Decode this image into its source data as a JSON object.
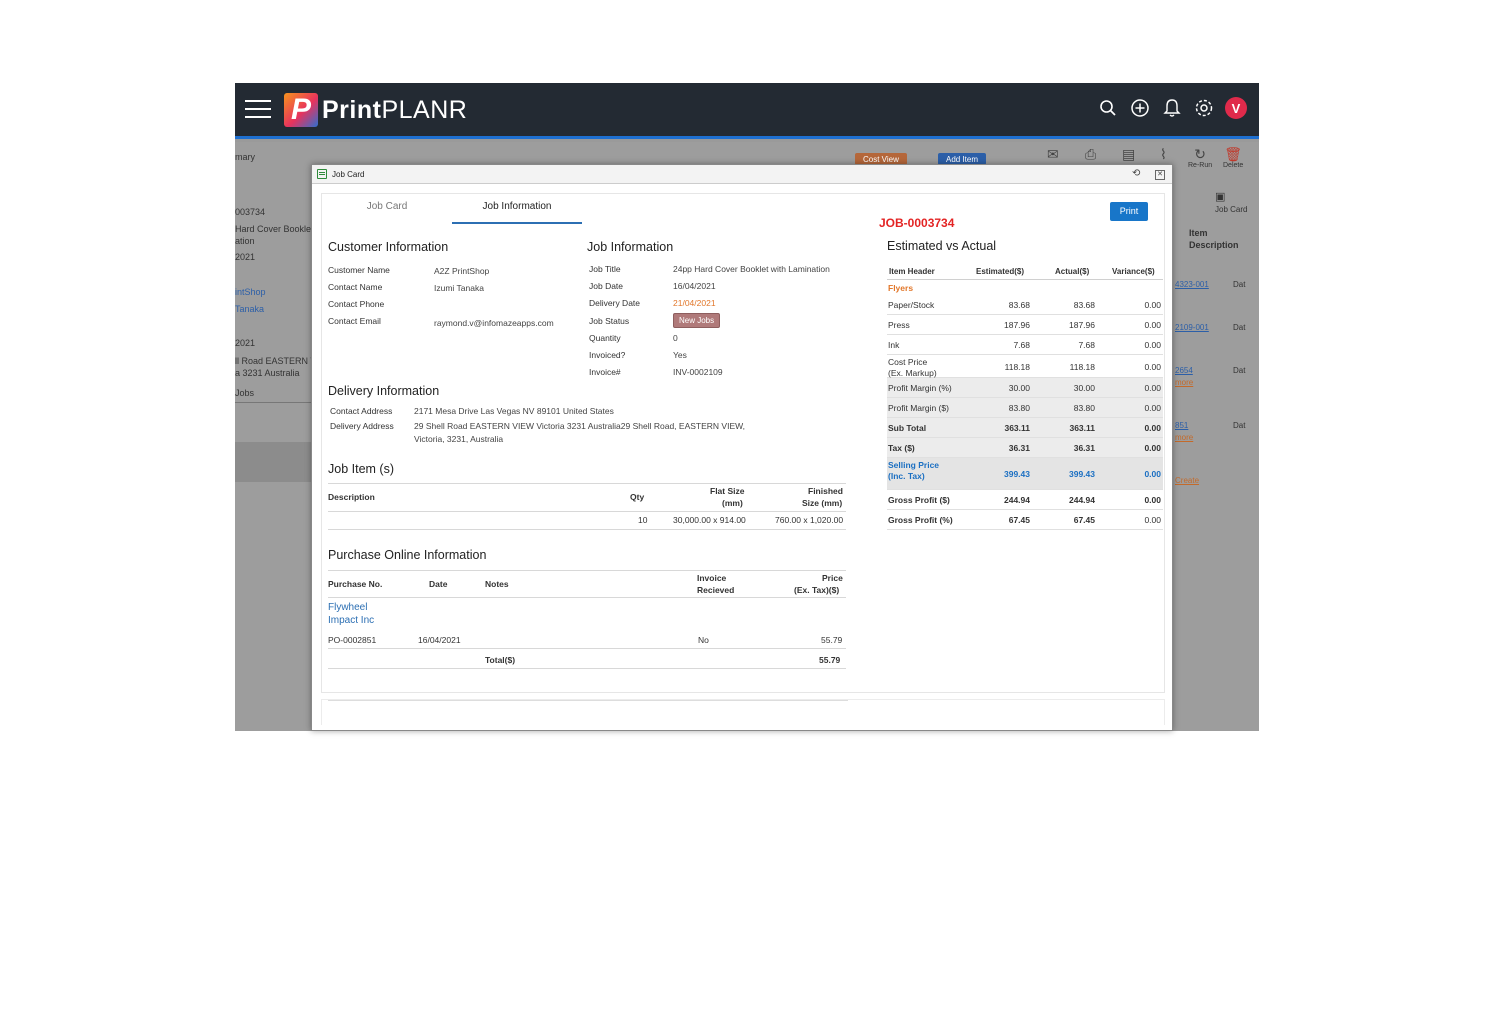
{
  "app": {
    "logo_letter": "P",
    "logo_print": "Print",
    "logo_planr": "PLANR",
    "avatar_letter": "V",
    "accent": "#1e6fd0"
  },
  "background": {
    "left_items": [
      "mary",
      "003734",
      "Hard Cover Booklet",
      "ation",
      "2021",
      "intShop",
      "Tanaka",
      "2021",
      "ll Road EASTERN VI",
      "a 3231 Australia",
      "Jobs"
    ],
    "cost_view_label": "Cost View",
    "add_item_label": "Add Item",
    "tools": [
      "",
      "",
      "",
      "",
      "Re-Run",
      "Delete"
    ],
    "job_card_label": "Job Card",
    "item_label": "Item",
    "description_label": "Description",
    "right_items": [
      "4323-001",
      "2109-001",
      "2654",
      "more",
      "851",
      "more",
      "Create"
    ],
    "dat_labels": [
      "Dat",
      "Dat",
      "Dat",
      "Dat"
    ]
  },
  "modal": {
    "title": "Job Card",
    "tabs": [
      "Job Card",
      "Job Information"
    ],
    "job_number": "JOB-0003734",
    "print_label": "Print",
    "customer": {
      "heading": "Customer Information",
      "rows": [
        {
          "label": "Customer Name",
          "value": "A2Z PrintShop"
        },
        {
          "label": "Contact Name",
          "value": "Izumi Tanaka"
        },
        {
          "label": "Contact Phone",
          "value": ""
        },
        {
          "label": "Contact Email",
          "value": "raymond.v@infomazeapps.com"
        }
      ]
    },
    "job": {
      "heading": "Job Information",
      "title_label": "Job Title",
      "title_value": "24pp Hard Cover Booklet with Lamination",
      "date_label": "Job Date",
      "date_value": "16/04/2021",
      "delivery_label": "Delivery Date",
      "delivery_value": "21/04/2021",
      "status_label": "Job Status",
      "status_value": "New Jobs",
      "qty_label": "Quantity",
      "qty_value": "0",
      "invoiced_label": "Invoiced?",
      "invoiced_value": "Yes",
      "invoice_label": "Invoice#",
      "invoice_value": "INV-0002109"
    },
    "delivery": {
      "heading": "Delivery Information",
      "contact_label": "Contact Address",
      "contact_value": "2171 Mesa Drive Las Vegas NV 89101 United States",
      "delivery_label": "Delivery Address",
      "delivery_value_1": "29 Shell Road EASTERN VIEW Victoria 3231 Australia29 Shell Road, EASTERN VIEW,",
      "delivery_value_2": "Victoria, 3231, Australia"
    },
    "job_items": {
      "heading": "Job Item (s)",
      "col_description": "Description",
      "col_qty": "Qty",
      "col_flat_1": "Flat Size",
      "col_flat_2": "(mm)",
      "col_fin_1": "Finished",
      "col_fin_2": "Size (mm)",
      "rows": [
        {
          "description": "",
          "qty": "10",
          "flat": "30,000.00 x 914.00",
          "finished": "760.00 x 1,020.00"
        }
      ]
    },
    "purchase": {
      "heading": "Purchase Online Information",
      "col_no": "Purchase No.",
      "col_date": "Date",
      "col_notes": "Notes",
      "col_inv_1": "Invoice",
      "col_inv_2": "Recieved",
      "col_price_1": "Price",
      "col_price_2": "(Ex. Tax)($)",
      "supplier_1": "Flywheel",
      "supplier_2": "Impact Inc",
      "row": {
        "no": "PO-0002851",
        "date": "16/04/2021",
        "notes": "",
        "invoice": "No",
        "price": "55.79"
      },
      "total_label": "Total($)",
      "total_value": "55.79"
    },
    "estimate": {
      "heading": "Estimated vs Actual",
      "col_item": "Item Header",
      "col_est": "Estimated($)",
      "col_act": "Actual($)",
      "col_var": "Variance($)",
      "category": "Flyers",
      "category_color": "#e2772a",
      "rows": [
        {
          "label": "Paper/Stock",
          "est": "83.68",
          "act": "83.68",
          "var": "0.00"
        },
        {
          "label": "Press",
          "est": "187.96",
          "act": "187.96",
          "var": "0.00"
        },
        {
          "label": "Ink",
          "est": "7.68",
          "act": "7.68",
          "var": "0.00"
        },
        {
          "label": "Cost Price",
          "label2": "(Ex. Markup)",
          "est": "118.18",
          "act": "118.18",
          "var": "0.00"
        },
        {
          "label": "Profit Margin (%)",
          "est": "30.00",
          "act": "30.00",
          "var": "0.00"
        },
        {
          "label": "Profit Margin ($)",
          "est": "83.80",
          "act": "83.80",
          "var": "0.00"
        },
        {
          "label": "Sub Total",
          "est": "363.11",
          "act": "363.11",
          "var": "0.00"
        },
        {
          "label": "Tax ($)",
          "est": "36.31",
          "act": "36.31",
          "var": "0.00"
        },
        {
          "label": "Selling Price",
          "label2": "(Inc. Tax)",
          "est": "399.43",
          "act": "399.43",
          "var": "0.00"
        },
        {
          "label": "Gross Profit ($)",
          "est": "244.94",
          "act": "244.94",
          "var": "0.00"
        },
        {
          "label": "Gross Profit (%)",
          "est": "67.45",
          "act": "67.45",
          "var": "0.00"
        }
      ]
    }
  }
}
